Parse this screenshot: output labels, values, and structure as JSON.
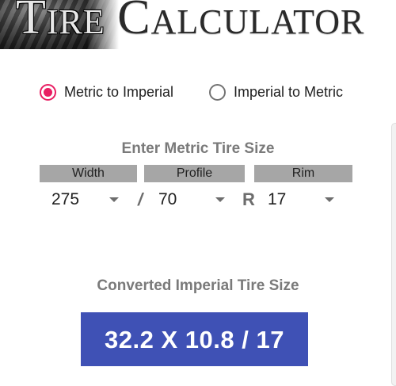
{
  "header": {
    "logo_part1_first": "T",
    "logo_part1_rest": "IRE",
    "logo_part2_first": "C",
    "logo_part2_rest": "ALCULATOR"
  },
  "conversion_mode": {
    "options": [
      {
        "label": "Metric to Imperial",
        "checked": true
      },
      {
        "label": "Imperial to Metric",
        "checked": false
      }
    ],
    "accent_color": "#e91e63"
  },
  "input_section": {
    "title": "Enter Metric Tire Size",
    "columns": {
      "width": "Width",
      "profile": "Profile",
      "rim": "Rim"
    },
    "values": {
      "width": "275",
      "profile": "70",
      "rim": "17"
    },
    "separator_slash": "/",
    "separator_r": "R"
  },
  "result_section": {
    "title": "Converted Imperial Tire Size",
    "value": "32.2 X 10.8 / 17",
    "background_color": "#3f51b5"
  }
}
